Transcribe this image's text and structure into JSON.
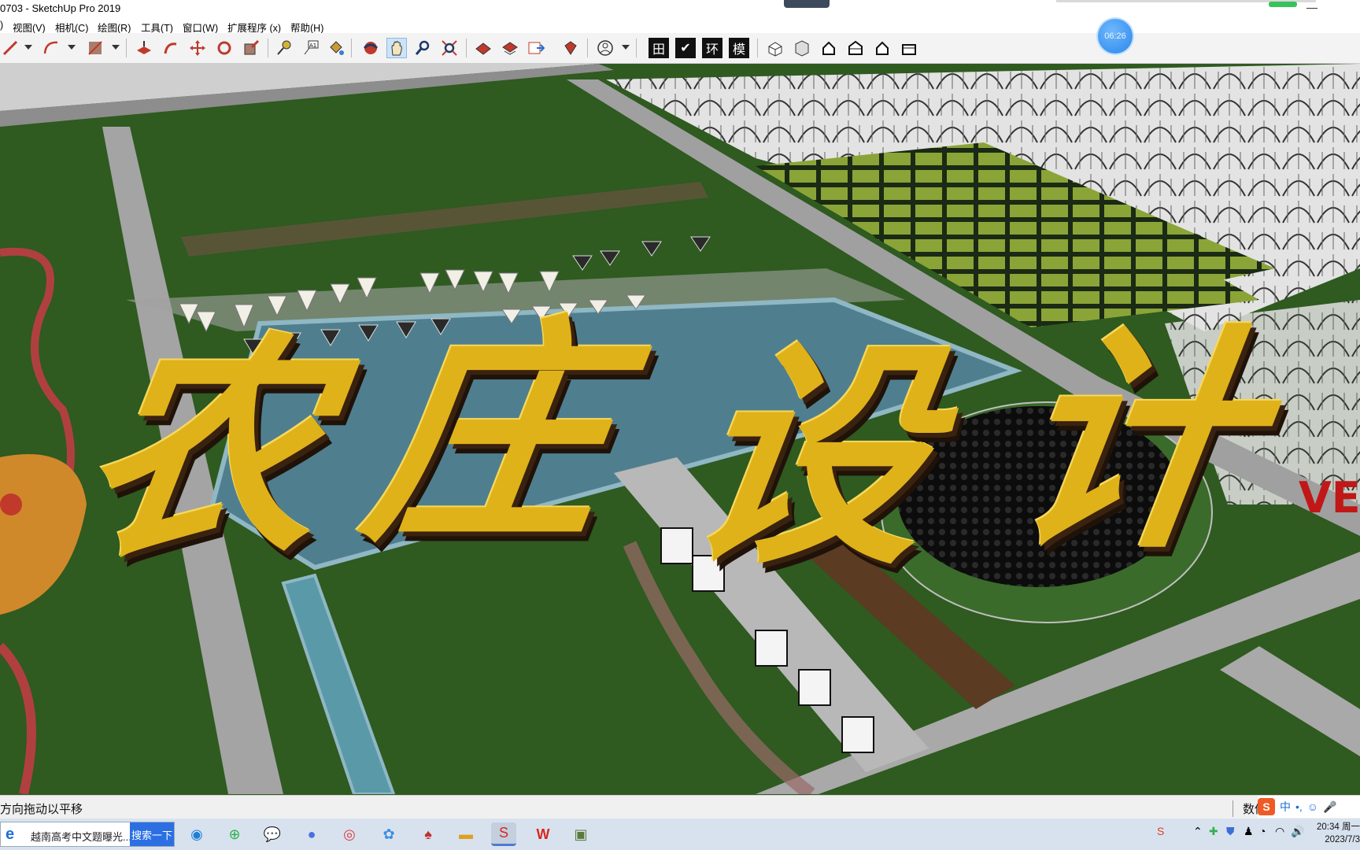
{
  "window": {
    "title": "0703 - SketchUp Pro 2019"
  },
  "menu": {
    "items": [
      {
        "label": ")"
      },
      {
        "label": "视图(V)"
      },
      {
        "label": "相机(C)"
      },
      {
        "label": "绘图(R)"
      },
      {
        "label": "工具(T)"
      },
      {
        "label": "窗口(W)"
      },
      {
        "label": "扩展程序 (x)"
      },
      {
        "label": "帮助(H)"
      }
    ]
  },
  "toolbar": {
    "text_buttons": {
      "grid": "田",
      "check": "✔",
      "env": "环",
      "model": "模"
    },
    "active_tool": "pan-tool"
  },
  "recording_timer": "06:26",
  "overlay": {
    "char1": "农",
    "char2": "庄",
    "char3": "设",
    "char4": "计",
    "sign_text": "VE"
  },
  "status": {
    "hint": "方向拖动以平移",
    "measurements_label": "数值"
  },
  "ime": {
    "logo": "S",
    "lang": "中",
    "punct": "•,"
  },
  "taskbar": {
    "search_query": "越南高考中文题曝光...",
    "search_button": "搜索一下",
    "apps": [
      "edge-icon",
      "green-app-icon",
      "wechat-icon",
      "browser-icon",
      "netease-music-icon",
      "photos-icon",
      "cards-icon",
      "file-explorer-icon",
      "sketchup-icon",
      "wps-icon",
      "image-viewer-icon"
    ]
  },
  "clock": {
    "time": "20:34 周一",
    "date": "2023/7/3"
  },
  "colors": {
    "gold": "#e0b21a",
    "grass": "#2f5a20",
    "water": "#4f7f8f",
    "road": "#a9a9a9"
  }
}
